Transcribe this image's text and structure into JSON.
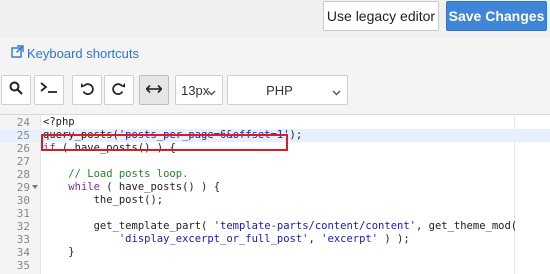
{
  "header": {
    "legacy_label": "Use legacy editor",
    "save_label": "Save Changes"
  },
  "shortcuts": {
    "label": "Keyboard shortcuts"
  },
  "toolbar": {
    "font_size": "13px",
    "language": "PHP",
    "buttons": [
      "search-icon",
      "terminal-icon",
      "undo-icon",
      "redo-icon",
      "wrap-arrows-icon"
    ]
  },
  "editor": {
    "lines": [
      {
        "n": "24",
        "fold": false,
        "code": "<?php"
      },
      {
        "n": "25",
        "fold": false,
        "code": "query_posts('posts_per_page=6&offset=1');"
      },
      {
        "n": "26",
        "fold": false,
        "code": "if ( have_posts() ) {"
      },
      {
        "n": "27",
        "fold": false,
        "code": ""
      },
      {
        "n": "28",
        "fold": false,
        "code": "    // Load posts loop."
      },
      {
        "n": "29",
        "fold": true,
        "code": "    while ( have_posts() ) {"
      },
      {
        "n": "30",
        "fold": false,
        "code": "        the_post();"
      },
      {
        "n": "31",
        "fold": false,
        "code": ""
      },
      {
        "n": "32",
        "fold": false,
        "code": "        get_template_part( 'template-parts/content/content', get_theme_mod("
      },
      {
        "n": "33",
        "fold": false,
        "code": "            'display_excerpt_or_full_post', 'excerpt' ) );"
      },
      {
        "n": "34",
        "fold": false,
        "code": "    }"
      },
      {
        "n": "35",
        "fold": false,
        "code": ""
      }
    ]
  },
  "colors": {
    "save_bg": "#3f86d8",
    "link": "#3076c8",
    "highlight_border": "#d42020"
  }
}
